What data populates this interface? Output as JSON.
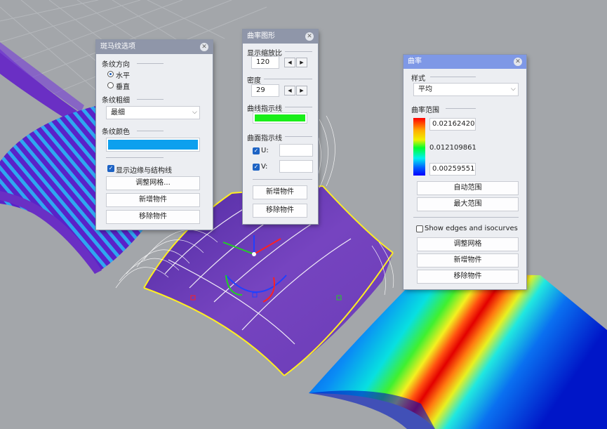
{
  "zebra_panel": {
    "title": "斑马纹选项",
    "direction_label": "条纹方向",
    "option_horizontal": "水平",
    "option_vertical": "垂直",
    "selected_direction": "水平",
    "thickness_label": "条纹粗细",
    "thickness_value": "最细",
    "color_label": "条纹颜色",
    "stripe_color": "#0da0ee",
    "show_edges_label": "显示边缘与结构线",
    "show_edges_checked": true,
    "adjust_mesh_button": "调整网格...",
    "add_object_button": "新增物件",
    "remove_object_button": "移除物件"
  },
  "curvature_graph_panel": {
    "title": "曲率图形",
    "scale_label": "显示缩放比",
    "scale_value": "120",
    "density_label": "密度",
    "density_value": "29",
    "curve_hair_label": "曲线指示线",
    "curve_hair_color": "#19ee19",
    "surface_hair_label": "曲面指示线",
    "u_label": "U:",
    "v_label": "V:",
    "u_checked": true,
    "v_checked": true,
    "add_object_button": "新增物件",
    "remove_object_button": "移除物件"
  },
  "curvature_panel": {
    "title": "曲率",
    "style_label": "样式",
    "style_value": "平均",
    "range_label": "曲率范围",
    "max_value": "0.0216242051",
    "mid_value": "0.012109861",
    "min_value": "0.0025955180",
    "auto_range_button": "自动范围",
    "max_range_button": "最大范围",
    "show_edges_label": "Show edges and isocurves",
    "show_edges_checked": false,
    "adjust_mesh_button": "调整网格",
    "add_object_button": "新增物件",
    "remove_object_button": "移除物件"
  },
  "viewport": {
    "background_color": "#a3a6aa",
    "grid_color": "#b5b8bc",
    "zebra_surface_color": "#6a2fc4",
    "main_surface_color": "#6e3fb4",
    "edge_highlight_color": "#ffee22"
  }
}
